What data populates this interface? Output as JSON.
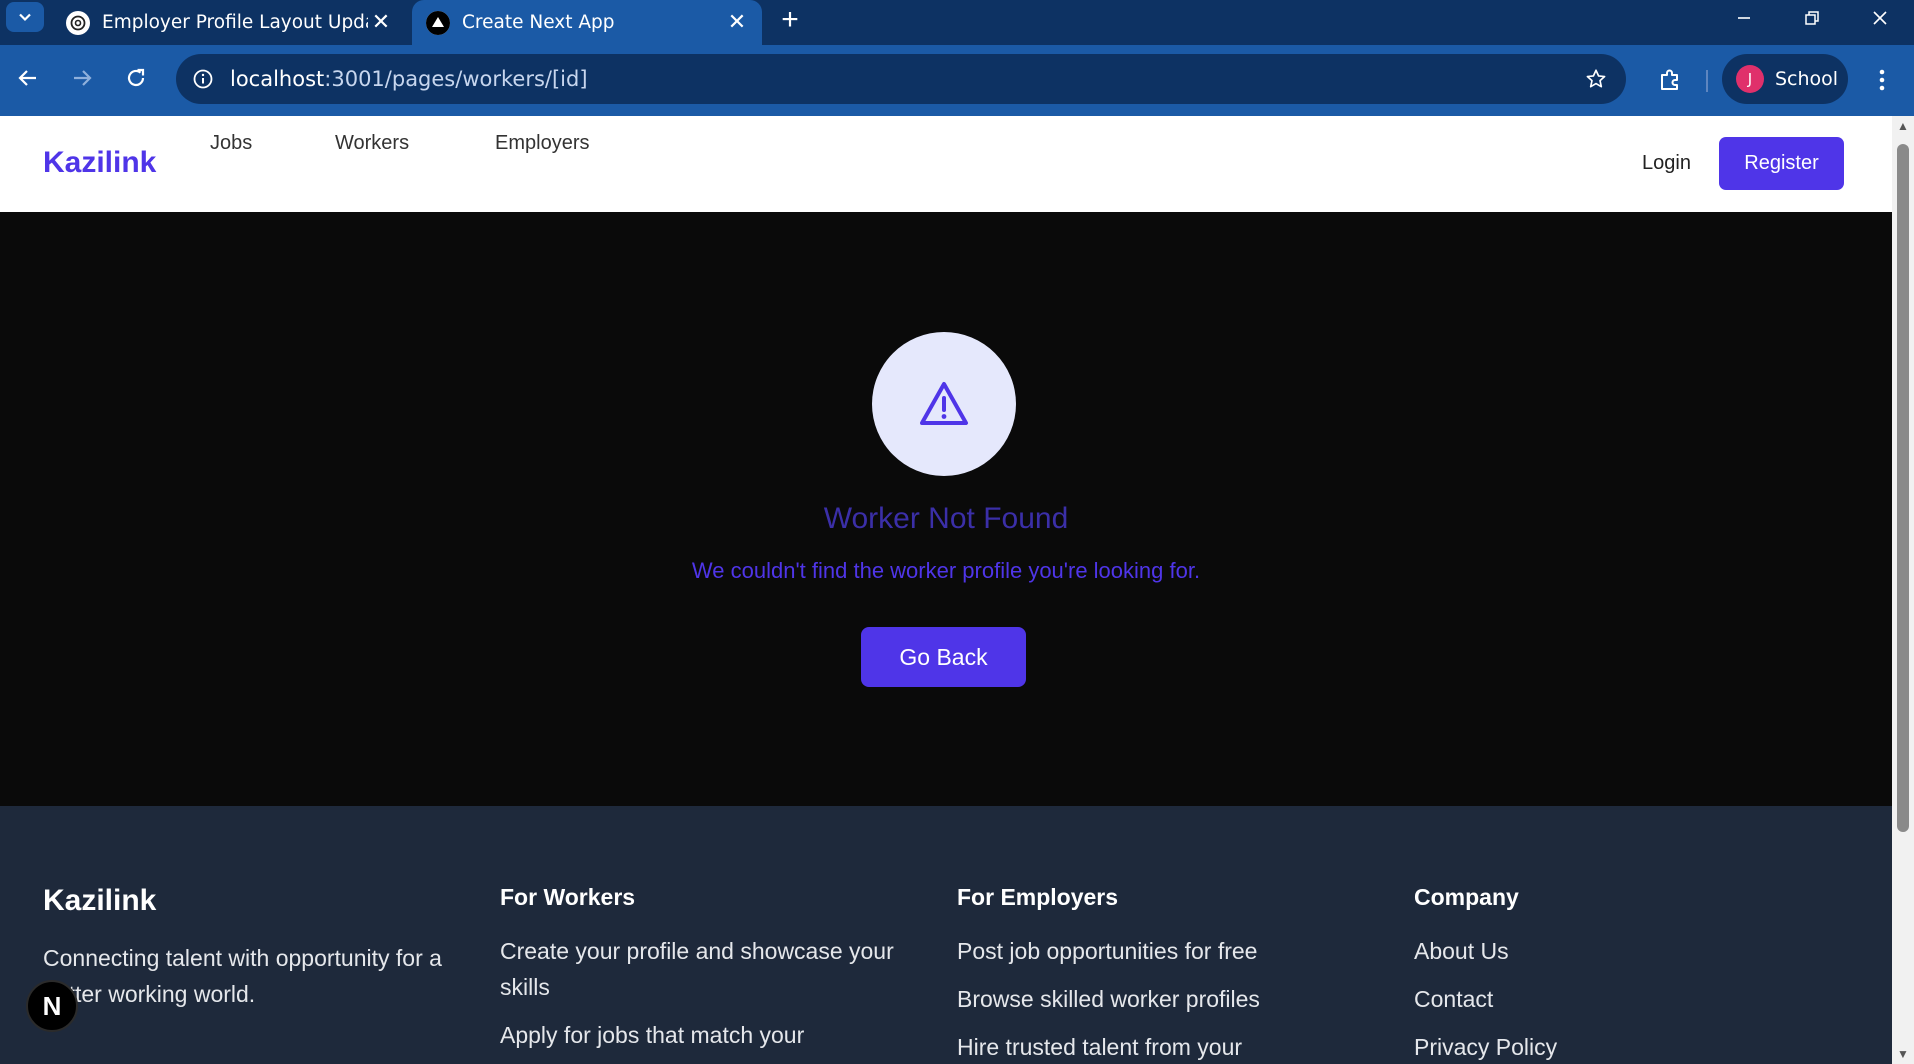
{
  "browser": {
    "tabs": [
      {
        "title": "Employer Profile Layout Update",
        "active": false,
        "icon": "openai-icon"
      },
      {
        "title": "Create Next App",
        "active": true,
        "icon": "vercel-triangle-icon"
      }
    ],
    "url_host": "localhost",
    "url_rest": ":3001/pages/workers/[id]",
    "profile_initial": "J",
    "profile_name": "School"
  },
  "site": {
    "logo": "Kazilink",
    "nav": [
      "Jobs",
      "Workers",
      "Employers"
    ],
    "login": "Login",
    "register": "Register"
  },
  "error": {
    "icon": "warning-triangle-icon",
    "title": "Worker Not Found",
    "message": "We couldn't find the worker profile you're looking for.",
    "button": "Go Back"
  },
  "footer": {
    "brand": "Kazilink",
    "tagline": "Connecting talent with opportunity for a better working world.",
    "columns": [
      {
        "heading": "For Workers",
        "items": [
          "Create your profile and showcase your skills",
          "Apply for jobs that match your"
        ]
      },
      {
        "heading": "For Employers",
        "items": [
          "Post job opportunities for free",
          "Browse skilled worker profiles",
          "Hire trusted talent from your"
        ]
      },
      {
        "heading": "Company",
        "items": [
          "About Us",
          "Contact",
          "Privacy Policy"
        ]
      }
    ]
  },
  "dev_badge": "N",
  "colors": {
    "accent": "#4f35e8",
    "footer_bg": "#1e293b",
    "chrome": "#1b5aa6"
  }
}
